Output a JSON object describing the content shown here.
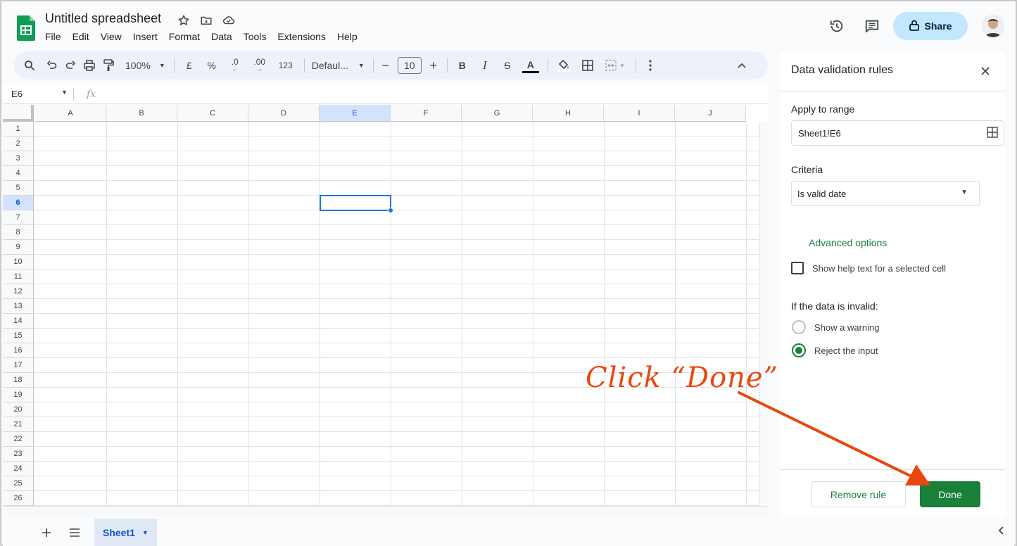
{
  "app": {
    "title": "Untitled spreadsheet",
    "menu": [
      "File",
      "Edit",
      "View",
      "Insert",
      "Format",
      "Data",
      "Tools",
      "Extensions",
      "Help"
    ],
    "share_label": "Share"
  },
  "toolbar": {
    "zoom": "100%",
    "currency": "£",
    "percent": "%",
    "dec_decrease": ".0",
    "dec_increase": ".00",
    "number_format": "123",
    "font": "Defaul...",
    "font_size": "10",
    "bold": "B",
    "italic": "I",
    "strikethrough": "S",
    "text_color": "A"
  },
  "formula_bar": {
    "name_box": "E6",
    "fx": "fx"
  },
  "grid": {
    "columns": [
      "A",
      "B",
      "C",
      "D",
      "E",
      "F",
      "G",
      "H",
      "I",
      "J"
    ],
    "rows": [
      "1",
      "2",
      "3",
      "4",
      "5",
      "6",
      "7",
      "8",
      "9",
      "10",
      "11",
      "12",
      "13",
      "14",
      "15",
      "16",
      "17",
      "18",
      "19",
      "20",
      "21",
      "22",
      "23",
      "24",
      "25",
      "26"
    ],
    "selected_cell": "E6"
  },
  "sheets": {
    "tabs": [
      {
        "label": "Sheet1"
      }
    ]
  },
  "panel": {
    "title": "Data validation rules",
    "apply_label": "Apply to range",
    "range_value": "Sheet1!E6",
    "criteria_label": "Criteria",
    "criteria_value": "Is valid date",
    "advanced_label": "Advanced options",
    "help_text_label": "Show help text for a selected cell",
    "invalid_label": "If the data is invalid:",
    "option_warning": "Show a warning",
    "option_reject": "Reject the input",
    "remove_label": "Remove rule",
    "done_label": "Done"
  },
  "annotation": {
    "text": "Click “Done”"
  },
  "colors": {
    "accent_green": "#188038",
    "selection_blue": "#1a73e8",
    "annotation": "#e8470f",
    "share_bg": "#c2e7ff"
  }
}
